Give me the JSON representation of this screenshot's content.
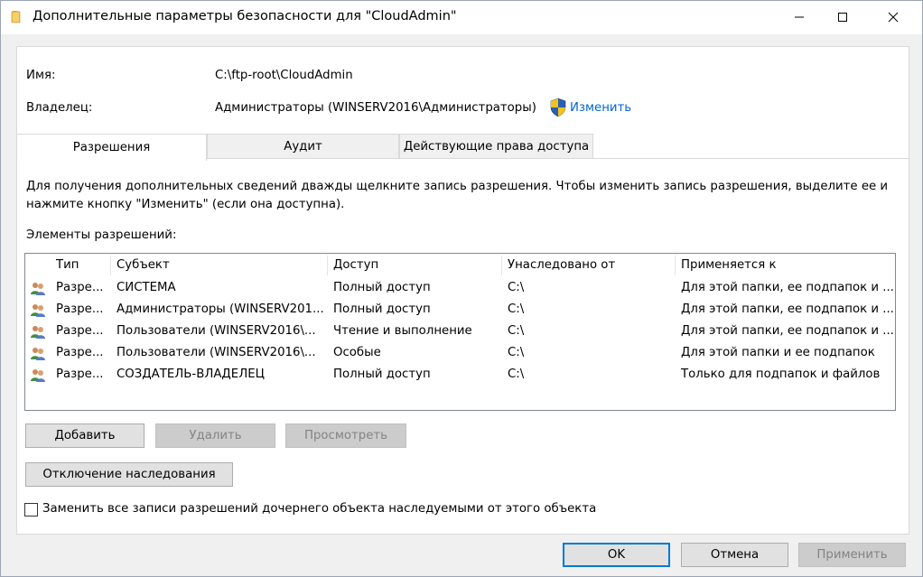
{
  "window": {
    "title": "Дополнительные параметры безопасности  для \"CloudAdmin\"",
    "icons": {
      "app": "folder-icon",
      "minimize": "minimize-icon",
      "maximize": "maximize-icon",
      "close": "close-icon"
    }
  },
  "info": {
    "name_label": "Имя:",
    "name_value": "C:\\ftp-root\\CloudAdmin",
    "owner_label": "Владелец:",
    "owner_value": "Администраторы (WINSERV2016\\Администраторы)",
    "change_link": "Изменить"
  },
  "tabs": [
    {
      "label": "Разрешения",
      "active": true
    },
    {
      "label": "Аудит",
      "active": false
    },
    {
      "label": "Действующие права доступа",
      "active": false
    }
  ],
  "permissions": {
    "instructions_line1": "Для получения дополнительных сведений дважды щелкните запись разрешения. Чтобы изменить запись разрешения, выделите ее и",
    "instructions_line2": "нажмите кнопку \"Изменить\" (если она доступна).",
    "list_label": "Элементы разрешений:",
    "columns": [
      "Тип",
      "Субъект",
      "Доступ",
      "Унаследовано от",
      "Применяется к"
    ],
    "rows": [
      {
        "type": "Разре...",
        "principal": "СИСТЕМА",
        "access": "Полный доступ",
        "inherited": "C:\\",
        "applies": "Для этой папки, ее подпапок и ..."
      },
      {
        "type": "Разре...",
        "principal": "Администраторы (WINSERV201...",
        "access": "Полный доступ",
        "inherited": "C:\\",
        "applies": "Для этой папки, ее подпапок и ..."
      },
      {
        "type": "Разре...",
        "principal": "Пользователи (WINSERV2016\\...",
        "access": "Чтение и выполнение",
        "inherited": "C:\\",
        "applies": "Для этой папки, ее подпапок и ..."
      },
      {
        "type": "Разре...",
        "principal": "Пользователи (WINSERV2016\\...",
        "access": "Особые",
        "inherited": "C:\\",
        "applies": "Для этой папки и ее подпапок"
      },
      {
        "type": "Разре...",
        "principal": "СОЗДАТЕЛЬ-ВЛАДЕЛЕЦ",
        "access": "Полный доступ",
        "inherited": "C:\\",
        "applies": "Только для подпапок и файлов"
      }
    ],
    "row_icon": "users-icon"
  },
  "buttons": {
    "add": "Добавить",
    "remove": "Удалить",
    "view": "Просмотреть",
    "disable_inheritance": "Отключение наследования"
  },
  "replace_checkbox": {
    "label": "Заменить все записи разрешений дочернего объекта наследуемыми от этого объекта",
    "checked": false
  },
  "dialog_buttons": {
    "ok": "OK",
    "cancel": "Отмена",
    "apply": "Применить"
  },
  "colors": {
    "link": "#0066cc",
    "default_button_border": "#0078d7"
  }
}
